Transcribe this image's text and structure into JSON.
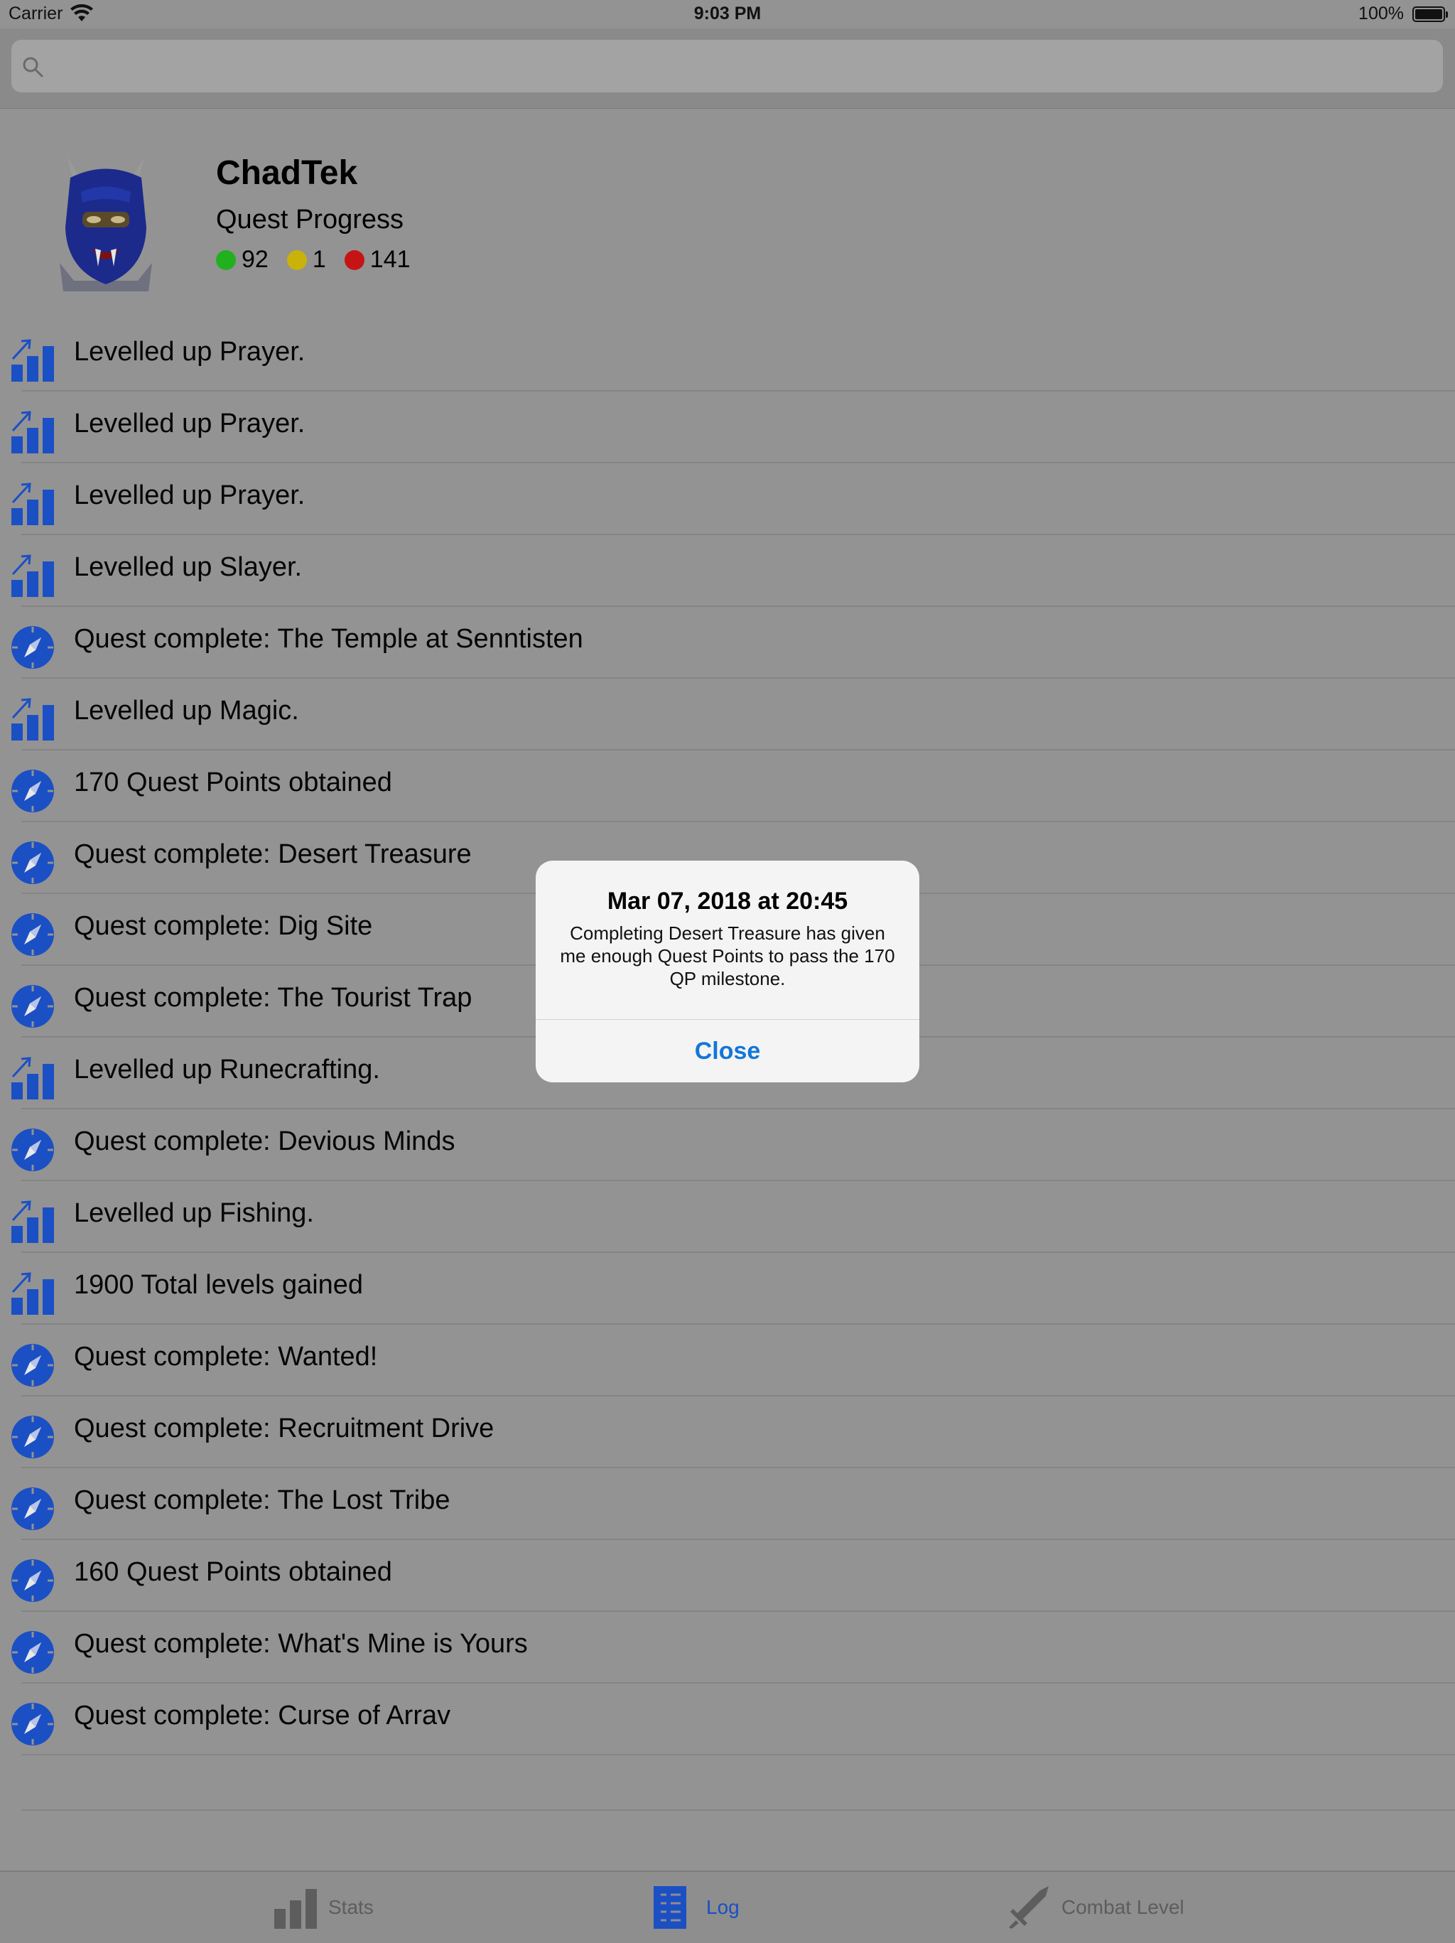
{
  "status_bar": {
    "carrier": "Carrier",
    "time": "9:03 PM",
    "battery": "100%"
  },
  "search": {
    "placeholder": "",
    "value": ""
  },
  "profile": {
    "name": "ChadTek",
    "progress_label": "Quest Progress",
    "completed": "92",
    "in_progress": "1",
    "not_started": "141",
    "colors": {
      "completed": "#22b01f",
      "in_progress": "#c9b20a",
      "not_started": "#c61414"
    }
  },
  "log": {
    "items": [
      {
        "type": "level-up",
        "text": "Levelled up Prayer."
      },
      {
        "type": "level-up",
        "text": "Levelled up Prayer."
      },
      {
        "type": "level-up",
        "text": "Levelled up Prayer."
      },
      {
        "type": "level-up",
        "text": "Levelled up Slayer."
      },
      {
        "type": "quest",
        "text": "Quest complete: The Temple at Senntisten"
      },
      {
        "type": "level-up",
        "text": "Levelled up Magic."
      },
      {
        "type": "quest",
        "text": "170 Quest Points obtained"
      },
      {
        "type": "quest",
        "text": "Quest complete: Desert Treasure"
      },
      {
        "type": "quest",
        "text": "Quest complete: Dig Site"
      },
      {
        "type": "quest",
        "text": "Quest complete: The Tourist Trap"
      },
      {
        "type": "level-up",
        "text": "Levelled up Runecrafting."
      },
      {
        "type": "quest",
        "text": "Quest complete: Devious Minds"
      },
      {
        "type": "level-up",
        "text": "Levelled up Fishing."
      },
      {
        "type": "level-up",
        "text": "1900 Total levels gained"
      },
      {
        "type": "quest",
        "text": "Quest complete: Wanted!"
      },
      {
        "type": "quest",
        "text": "Quest complete: Recruitment Drive"
      },
      {
        "type": "quest",
        "text": "Quest complete: The Lost Tribe"
      },
      {
        "type": "quest",
        "text": "160 Quest Points obtained"
      },
      {
        "type": "quest",
        "text": "Quest complete: What's Mine is Yours"
      },
      {
        "type": "quest",
        "text": "Quest complete: Curse of Arrav"
      }
    ]
  },
  "alert": {
    "title": "Mar 07, 2018 at 20:45",
    "message": "Completing Desert Treasure has given me enough Quest Points to pass the 170 QP milestone.",
    "button": "Close"
  },
  "tabbar": {
    "tabs": [
      {
        "label": "Stats",
        "icon": "stats-icon",
        "active": false
      },
      {
        "label": "Log",
        "icon": "log-icon",
        "active": true
      },
      {
        "label": "Combat Level",
        "icon": "sword-icon",
        "active": false
      }
    ]
  },
  "colors": {
    "accent": "#1b4fc4",
    "alert_button": "#1476d8",
    "dim_background": "#939393"
  }
}
